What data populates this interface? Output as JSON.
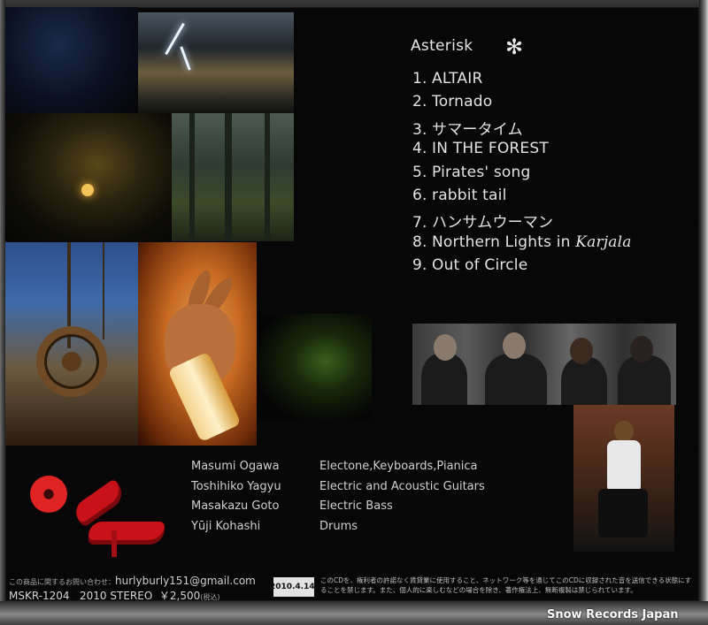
{
  "album": {
    "title": "Asterisk",
    "icon": "asterisk-icon"
  },
  "tracks": [
    {
      "num": "1.",
      "title": "ALTAIR"
    },
    {
      "num": "2.",
      "title": "Tornado"
    },
    {
      "num": "3.",
      "title": "サマータイム"
    },
    {
      "num": "4.",
      "title": "IN THE FOREST"
    },
    {
      "num": "5.",
      "title": "Pirates' song"
    },
    {
      "num": "6.",
      "title": "rabbit tail"
    },
    {
      "num": "7.",
      "title": "ハンサムウーマン"
    },
    {
      "num": "8.",
      "title": "Northern Lights in ",
      "title_italic": "Karjala"
    },
    {
      "num": "9.",
      "title": "Out of Circle"
    }
  ],
  "credits": [
    {
      "name": "Masumi Ogawa",
      "role": "Electone,Keyboards,Pianica"
    },
    {
      "name": "Toshihiko Yagyu",
      "role": "Electric and Acoustic Guitars"
    },
    {
      "name": "Masakazu Goto",
      "role": "Electric Bass"
    },
    {
      "name": "Yūji Kohashi",
      "role": "Drums"
    }
  ],
  "footer": {
    "contact_prefix": "この商品に関するお問い合わせ：",
    "contact_email": "hurlyburly151@gmail.com",
    "catalog": "MSKR-1204",
    "year_format": "2010 STEREO",
    "price": "￥2,500",
    "price_note": "(税込)",
    "release_date": "2010.4.14.",
    "notice": "このCDを、権利者の許諾なく賃貸業に使用すること、ネットワーク等を通じてこのCDに収録された音を送信できる状態にすることを禁じます。また、個人的に楽しむなどの場合を除き、著作権法上、無断複製は禁じられています。"
  },
  "watermark": "Snow Records Japan"
}
